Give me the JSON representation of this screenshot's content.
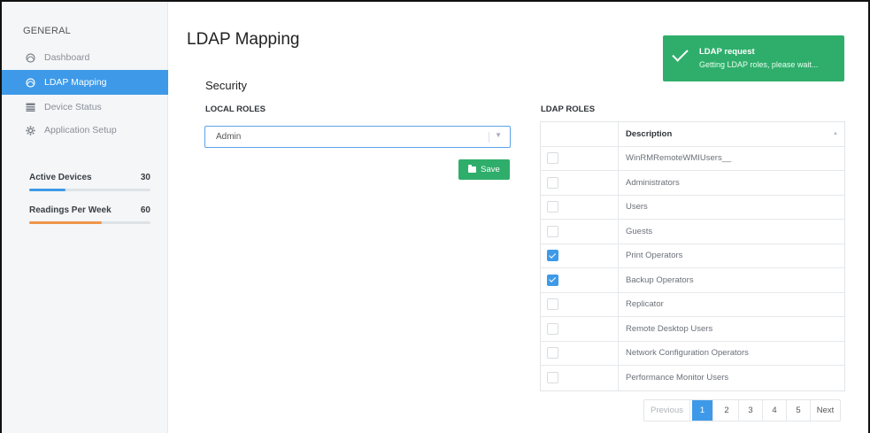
{
  "sidebar": {
    "heading": "GENERAL",
    "items": [
      {
        "label": "Dashboard",
        "icon": "dashboard-icon"
      },
      {
        "label": "LDAP Mapping",
        "icon": "dashboard-icon"
      },
      {
        "label": "Device Status",
        "icon": "table-icon"
      },
      {
        "label": "Application Setup",
        "icon": "gear-icon"
      }
    ],
    "stats": [
      {
        "label": "Active Devices",
        "value": "30",
        "fill_fraction": 0.3,
        "color": "#3e9ae8"
      },
      {
        "label": "Readings Per Week",
        "value": "60",
        "fill_fraction": 0.6,
        "color": "#f0954a"
      }
    ]
  },
  "main": {
    "title": "LDAP Mapping",
    "section": "Security",
    "local_roles": {
      "label": "LOCAL ROLES",
      "selected": "Admin"
    },
    "save_label": "Save",
    "ldap_roles": {
      "label": "LDAP ROLES",
      "column_header": "Description",
      "rows": [
        {
          "description": "WinRMRemoteWMIUsers__",
          "checked": false
        },
        {
          "description": "Administrators",
          "checked": false
        },
        {
          "description": "Users",
          "checked": false
        },
        {
          "description": "Guests",
          "checked": false
        },
        {
          "description": "Print Operators",
          "checked": true
        },
        {
          "description": "Backup Operators",
          "checked": true
        },
        {
          "description": "Replicator",
          "checked": false
        },
        {
          "description": "Remote Desktop Users",
          "checked": false
        },
        {
          "description": "Network Configuration Operators",
          "checked": false
        },
        {
          "description": "Performance Monitor Users",
          "checked": false
        }
      ]
    },
    "pagination": {
      "previous": "Previous",
      "pages": [
        "1",
        "2",
        "3",
        "4",
        "5"
      ],
      "current": "1",
      "next": "Next"
    }
  },
  "toast": {
    "title": "LDAP request",
    "message": "Getting LDAP roles, please wait..."
  }
}
